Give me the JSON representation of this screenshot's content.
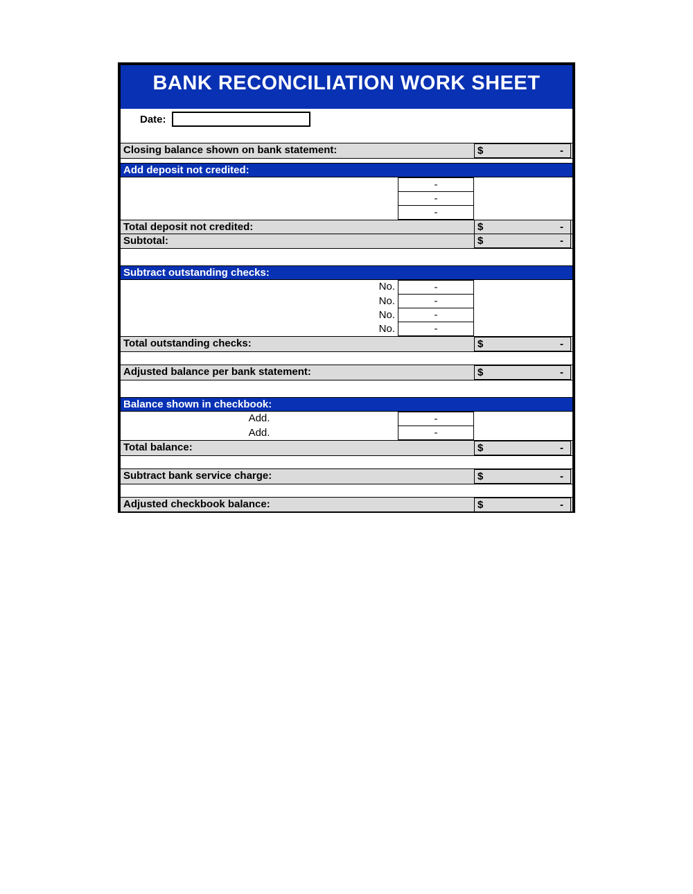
{
  "title": "BANK RECONCILIATION WORK SHEET",
  "date_label": "Date:",
  "dash": "-",
  "currency": "$",
  "labels": {
    "closing_balance": "Closing balance shown on bank statement:",
    "add_deposit": "Add deposit not credited:",
    "total_deposit": "Total deposit not credited:",
    "subtotal": "Subtotal:",
    "subtract_checks": "Subtract outstanding checks:",
    "check_no": "No.",
    "total_checks": "Total outstanding checks:",
    "adjusted_bank": "Adjusted balance per bank statement:",
    "balance_checkbook": "Balance shown in checkbook:",
    "add": "Add.",
    "total_balance": "Total balance:",
    "service_charge": "Subtract bank service charge:",
    "adjusted_checkbook": "Adjusted checkbook balance:"
  }
}
